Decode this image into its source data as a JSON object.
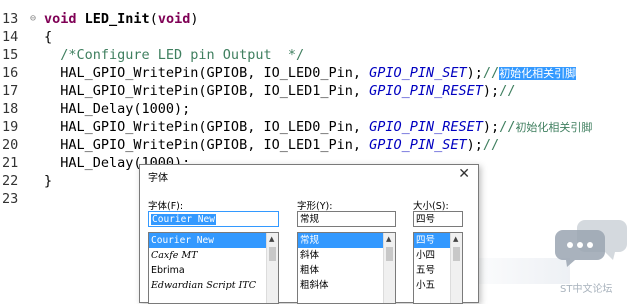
{
  "editor": {
    "lines": [
      {
        "num": "13",
        "fold": "⊖",
        "segments": [
          {
            "t": "void",
            "c": "kw"
          },
          {
            "t": " ",
            "c": ""
          },
          {
            "t": "LED_Init",
            "c": "fn"
          },
          {
            "t": "(",
            "c": ""
          },
          {
            "t": "void",
            "c": "kw"
          },
          {
            "t": ")",
            "c": ""
          }
        ]
      },
      {
        "num": "14",
        "fold": "",
        "segments": [
          {
            "t": "{",
            "c": ""
          }
        ]
      },
      {
        "num": "15",
        "fold": "",
        "segments": [
          {
            "t": "  /*Configure LED pin Output  */",
            "c": "cm"
          }
        ]
      },
      {
        "num": "16",
        "fold": "",
        "segments": [
          {
            "t": "  HAL_GPIO_WritePin(GPIOB, IO_LED0_Pin, ",
            "c": ""
          },
          {
            "t": "GPIO_PIN_SET",
            "c": "it"
          },
          {
            "t": ");",
            "c": ""
          },
          {
            "t": "//",
            "c": "cm"
          },
          {
            "t": "初始化相关引脚",
            "c": "cm-sel cjk"
          }
        ]
      },
      {
        "num": "17",
        "fold": "",
        "segments": [
          {
            "t": "  HAL_GPIO_WritePin(GPIOB, IO_LED1_Pin, ",
            "c": ""
          },
          {
            "t": "GPIO_PIN_RESET",
            "c": "it"
          },
          {
            "t": ");",
            "c": ""
          },
          {
            "t": "//",
            "c": "cm"
          }
        ]
      },
      {
        "num": "18",
        "fold": "",
        "segments": [
          {
            "t": "  HAL_Delay(1000);",
            "c": ""
          }
        ]
      },
      {
        "num": "19",
        "fold": "",
        "segments": [
          {
            "t": "  HAL_GPIO_WritePin(GPIOB, IO_LED0_Pin, ",
            "c": ""
          },
          {
            "t": "GPIO_PIN_RESET",
            "c": "it"
          },
          {
            "t": ");",
            "c": ""
          },
          {
            "t": "//",
            "c": "cm"
          },
          {
            "t": "初始化相关引脚",
            "c": "cm cjk"
          }
        ]
      },
      {
        "num": "20",
        "fold": "",
        "segments": [
          {
            "t": "  HAL_GPIO_WritePin(GPIOB, IO_LED1_Pin, ",
            "c": ""
          },
          {
            "t": "GPIO_PIN_SET",
            "c": "it"
          },
          {
            "t": ");",
            "c": ""
          },
          {
            "t": "//",
            "c": "cm"
          }
        ]
      },
      {
        "num": "21",
        "fold": "",
        "segments": [
          {
            "t": "  HAL_Delay(1000);",
            "c": ""
          }
        ]
      },
      {
        "num": "22",
        "fold": "",
        "segments": [
          {
            "t": "}",
            "c": ""
          }
        ]
      },
      {
        "num": "23",
        "fold": "",
        "segments": []
      }
    ]
  },
  "font_dialog": {
    "title": "字体",
    "close": "✕",
    "font_label": "字体(F):",
    "style_label": "字形(Y):",
    "size_label": "大小(S):",
    "font_value": "Courier New",
    "style_value": "常规",
    "size_value": "四号",
    "fonts": [
      "Courier New",
      "Caxfe MT",
      "Ebrima",
      "Edwardian Script ITC"
    ],
    "styles": [
      "常规",
      "斜体",
      "粗体",
      "粗斜体"
    ],
    "sizes": [
      "四号",
      "小四",
      "五号",
      "小五"
    ],
    "scroll_up": "▲"
  },
  "watermark": {
    "text": "ST中文论坛"
  },
  "colors": {
    "selection": "#3399ff",
    "keyword": "#7f0055",
    "constant": "#0000c0",
    "comment": "#3f7f5f"
  }
}
